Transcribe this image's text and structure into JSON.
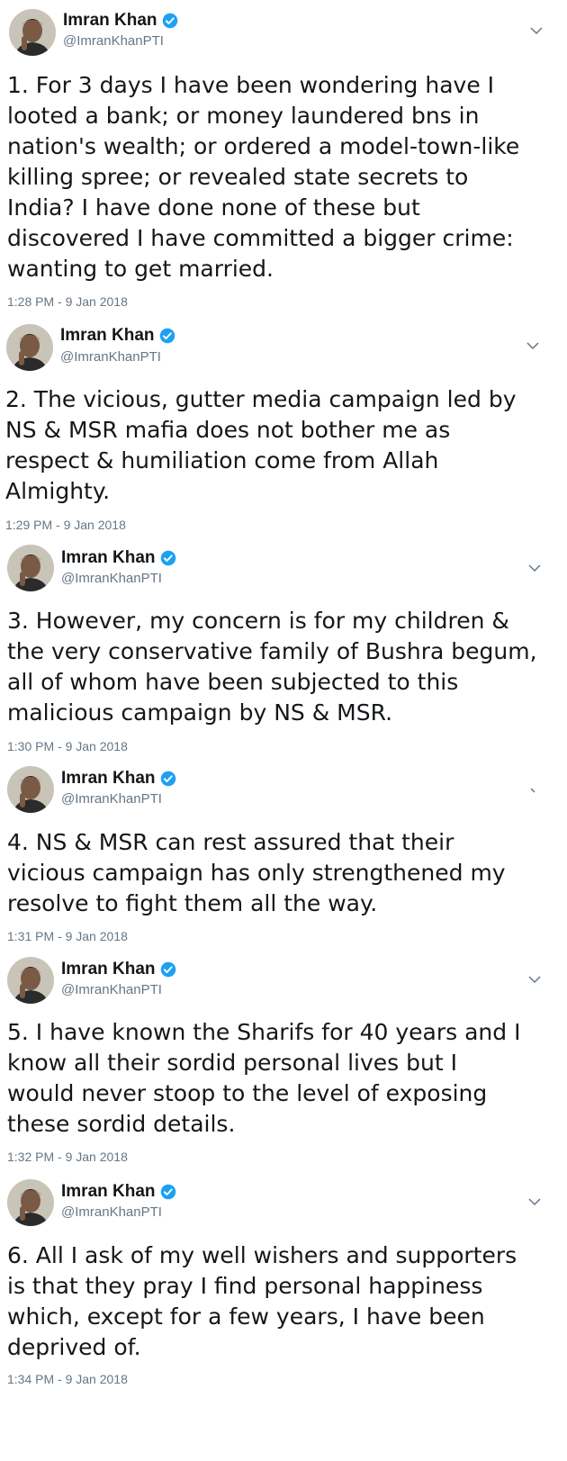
{
  "tweets": [
    {
      "author": {
        "name": "Imran Khan",
        "handle": "@ImranKhanPTI",
        "verified_icon": "verified-badge-icon",
        "avatar": "profile-photo"
      },
      "text": "1. For 3 days I have been wondering have I\nlooted a bank; or money laundered bns in\nnation's wealth; or ordered a model-town-like\nkilling spree; or revealed state secrets to\nIndia? I have done none of these but\ndiscovered I have committed a bigger crime:\nwanting to get married.",
      "timestamp": "1:28 PM - 9 Jan 2018",
      "menu_icon": "chevron-down-icon"
    },
    {
      "author": {
        "name": "Imran Khan",
        "handle": "@ImranKhanPTI",
        "verified_icon": "verified-badge-icon",
        "avatar": "profile-photo"
      },
      "text": "2. The vicious, gutter media campaign led by\nNS & MSR mafia does not bother me as\nrespect & humiliation come from Allah\nAlmighty.",
      "timestamp": "1:29 PM - 9 Jan 2018",
      "menu_icon": "chevron-down-icon"
    },
    {
      "author": {
        "name": "Imran Khan",
        "handle": "@ImranKhanPTI",
        "verified_icon": "verified-badge-icon",
        "avatar": "profile-photo"
      },
      "text": "3. However, my concern is for my children &\nthe very conservative family of Bushra begum,\nall of whom have been subjected to this\nmalicious campaign by NS & MSR.",
      "timestamp": "1:30 PM - 9 Jan 2018",
      "menu_icon": "chevron-down-icon"
    },
    {
      "author": {
        "name": "Imran Khan",
        "handle": "@ImranKhanPTI",
        "verified_icon": "verified-badge-icon",
        "avatar": "profile-photo"
      },
      "text": "4. NS & MSR can rest assured that their\nvicious campaign has only strengthened my\nresolve to fight them all the way.",
      "timestamp": "1:31 PM - 9 Jan 2018",
      "menu_icon": "chevron-down-icon"
    },
    {
      "author": {
        "name": "Imran Khan",
        "handle": "@ImranKhanPTI",
        "verified_icon": "verified-badge-icon",
        "avatar": "profile-photo"
      },
      "text": "5. I have known the Sharifs for 40 years and I\nknow all their sordid personal lives but I\nwould never stoop to the level of exposing\nthese sordid details.",
      "timestamp": "1:32 PM - 9 Jan 2018",
      "menu_icon": "chevron-down-icon"
    },
    {
      "author": {
        "name": "Imran Khan",
        "handle": "@ImranKhanPTI",
        "verified_icon": "verified-badge-icon",
        "avatar": "profile-photo"
      },
      "text": "6. All I ask of my well wishers and supporters\nis that they pray I find personal happiness\nwhich, except for a few years, I have been\ndeprived of.",
      "timestamp": "1:34 PM - 9 Jan 2018",
      "menu_icon": "chevron-down-icon"
    }
  ],
  "colors": {
    "text": "#14171a",
    "secondary": "#657786",
    "verified": "#1da1f2",
    "background": "#ffffff"
  }
}
